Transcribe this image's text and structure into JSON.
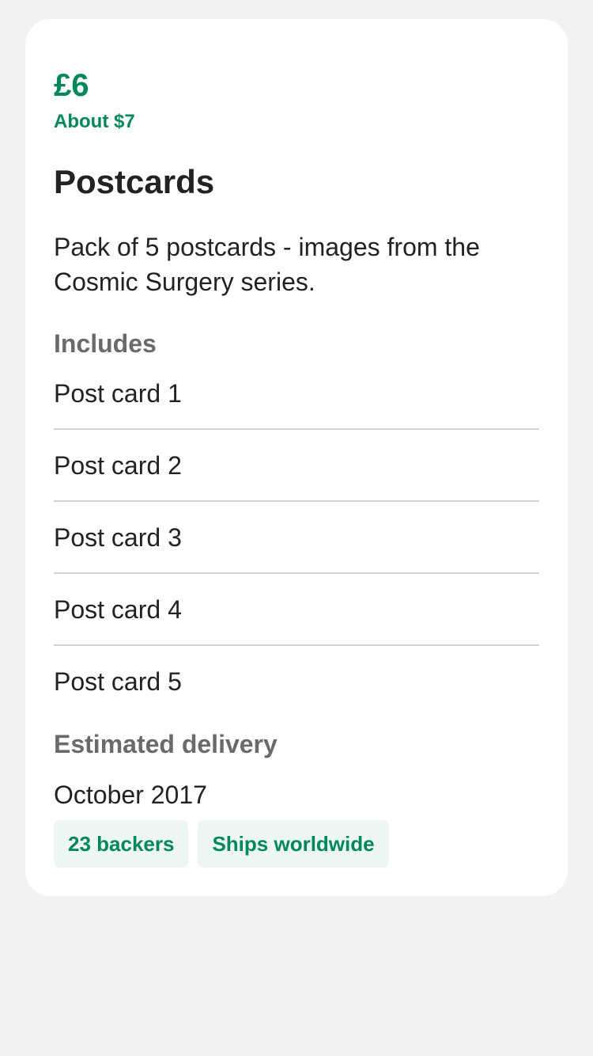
{
  "reward": {
    "price": "£6",
    "converted_price": "About $7",
    "title": "Postcards",
    "description": "Pack of 5 postcards - images from the Cosmic Surgery series.",
    "includes_label": "Includes",
    "includes": [
      "Post card 1",
      "Post card 2",
      "Post card 3",
      "Post card 4",
      "Post card 5"
    ],
    "delivery_label": "Estimated delivery",
    "delivery_value": "October 2017",
    "badges": {
      "backers": "23 backers",
      "shipping": "Ships worldwide"
    }
  },
  "colors": {
    "accent": "#028858",
    "badge_background": "#ecf6f2",
    "page_background": "#f2f2f2",
    "card_background": "#ffffff",
    "muted_label": "#6a6a6a"
  }
}
